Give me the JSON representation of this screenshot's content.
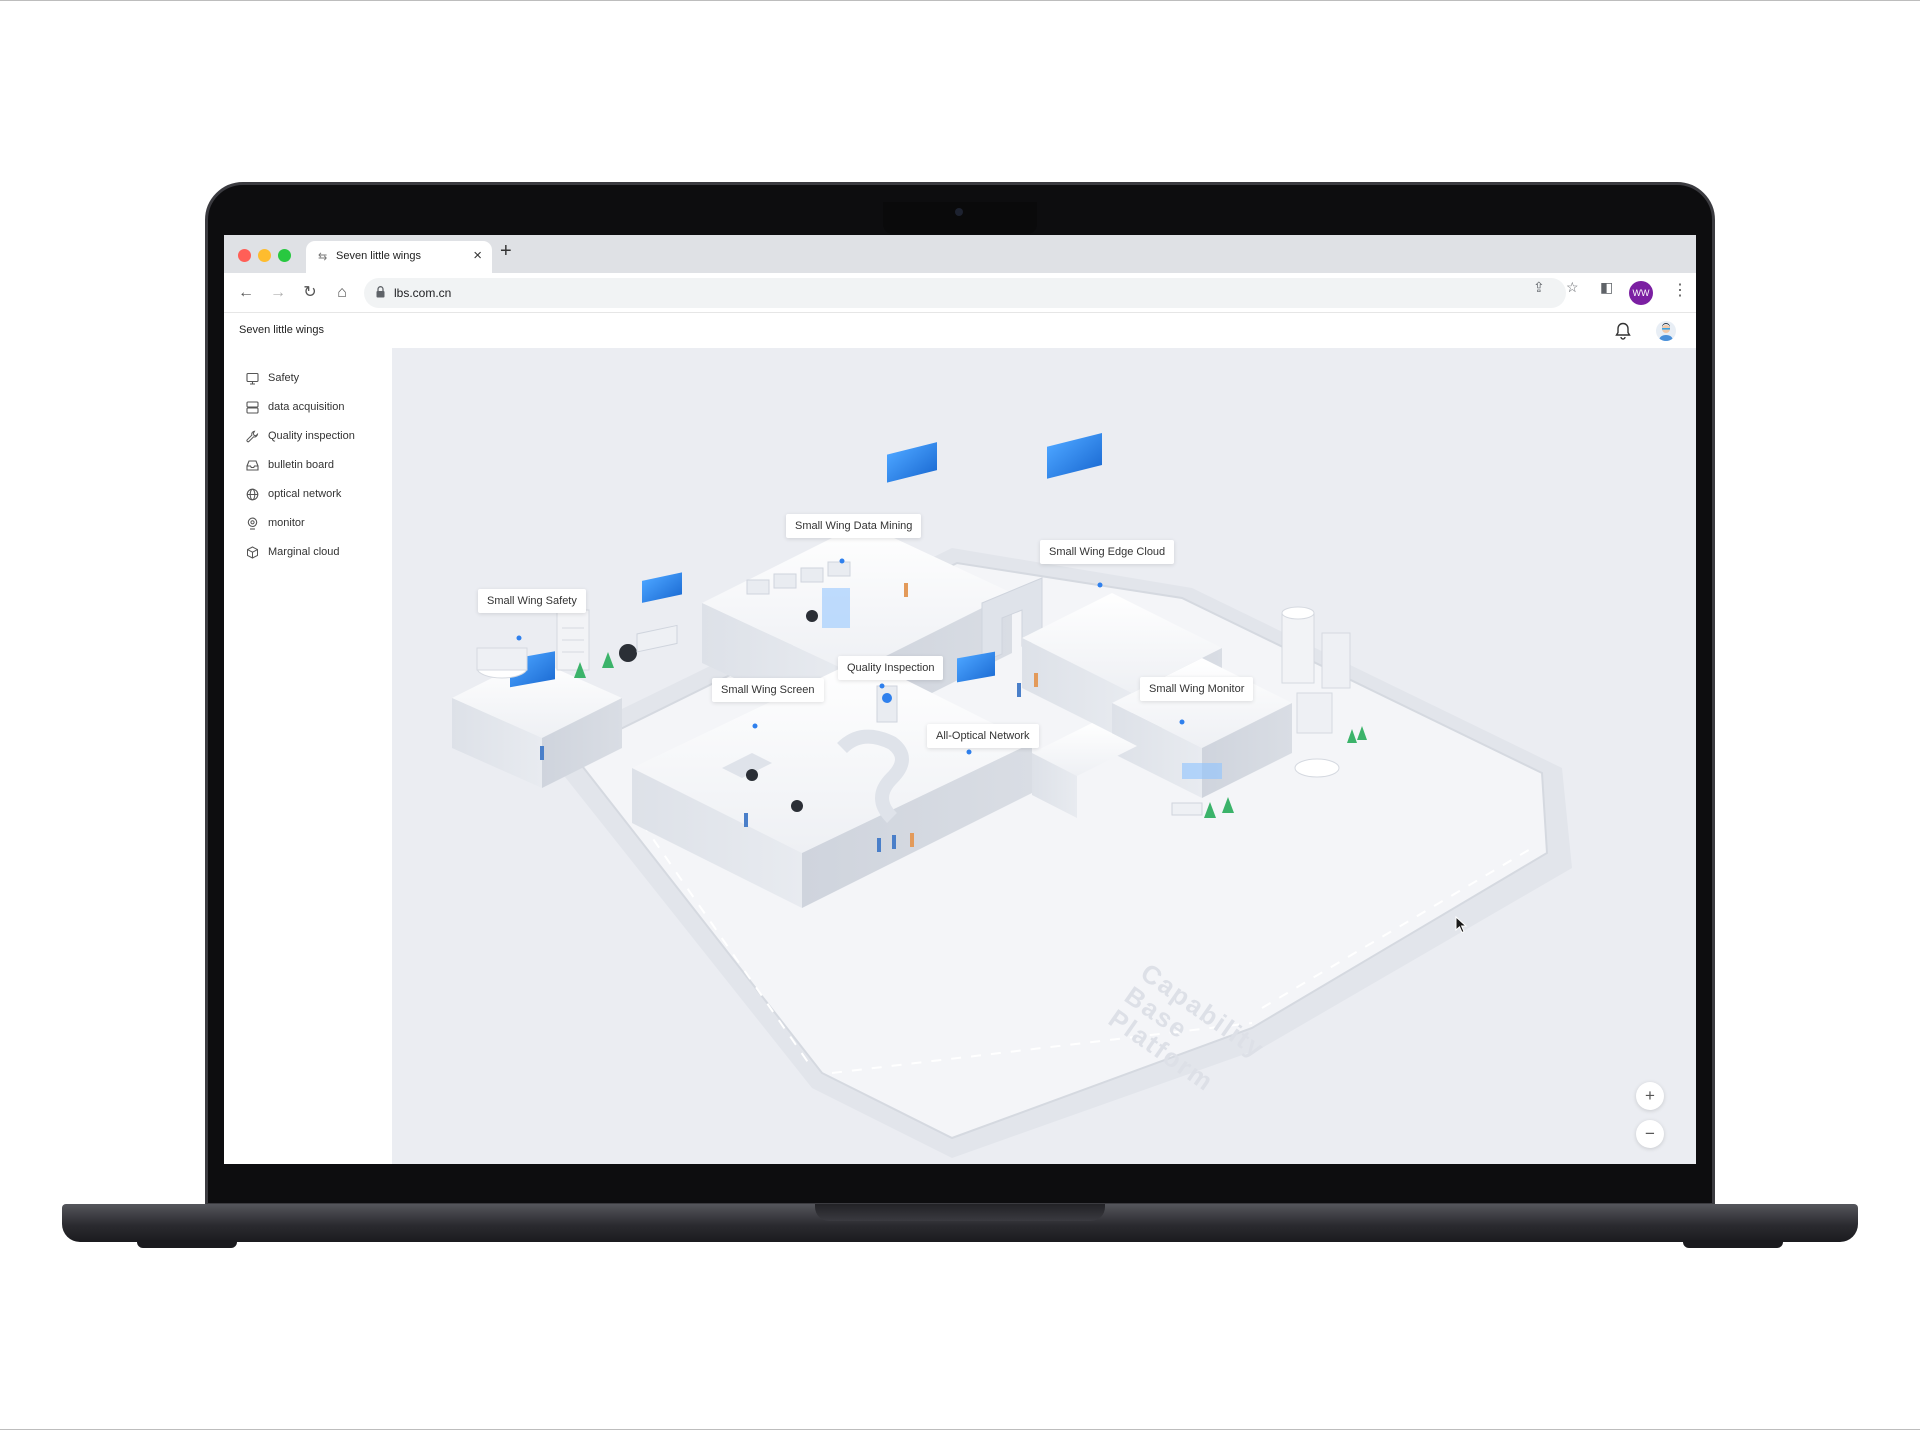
{
  "browser": {
    "tab_title": "Seven little wings",
    "url": "lbs.com.cn",
    "profile_initials": "WW"
  },
  "app": {
    "title": "Seven little wings"
  },
  "sidebar": {
    "items": [
      {
        "label": "Safety",
        "icon": "monitor-screen-icon"
      },
      {
        "label": "data acquisition",
        "icon": "server-stack-icon"
      },
      {
        "label": "Quality inspection",
        "icon": "wrench-icon"
      },
      {
        "label": "bulletin board",
        "icon": "inbox-tray-icon"
      },
      {
        "label": "optical network",
        "icon": "globe-icon"
      },
      {
        "label": "monitor",
        "icon": "camera-pin-icon"
      },
      {
        "label": "Marginal cloud",
        "icon": "cube-icon"
      }
    ]
  },
  "map": {
    "callouts": {
      "data_mining": "Small Wing Data Mining",
      "edge_cloud": "Small Wing Edge Cloud",
      "safety": "Small Wing Safety",
      "quality": "Quality Inspection",
      "screen": "Small Wing Screen",
      "monitor": "Small Wing Monitor",
      "optical": "All-Optical Network"
    },
    "watermark": [
      "Capability",
      "Base",
      "Platform"
    ],
    "zoom_in": "+",
    "zoom_out": "−"
  },
  "colors": {
    "accent_blue": "#2f80ed",
    "map_background": "#ebedf2",
    "profile_purple": "#7b1fa2"
  }
}
